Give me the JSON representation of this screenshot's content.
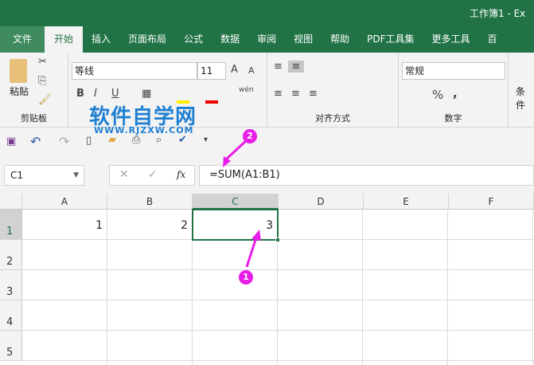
{
  "window": {
    "title": "工作簿1 - Ex"
  },
  "tabs": [
    "文件",
    "开始",
    "插入",
    "页面布局",
    "公式",
    "数据",
    "审阅",
    "视图",
    "帮助",
    "PDF工具集",
    "更多工具",
    "百"
  ],
  "ribbon": {
    "clipboard": {
      "paste": "粘贴",
      "label": "剪贴板"
    },
    "font": {
      "name": "等线",
      "size": "11",
      "phonetic": "wén"
    },
    "alignment": {
      "label": "对齐方式"
    },
    "number": {
      "format": "常规",
      "label": "数字",
      "percent": "%",
      "comma": ","
    },
    "styles": {
      "conditional": "条件"
    }
  },
  "watermark": {
    "text": "软件自学网",
    "url": "WWW.RJZXW.COM"
  },
  "formula_bar": {
    "name_box": "C1",
    "fx": "fx",
    "formula": "=SUM(A1:B1)"
  },
  "grid": {
    "columns": [
      "A",
      "B",
      "C",
      "D",
      "E",
      "F"
    ],
    "rows": [
      "1",
      "2",
      "3",
      "4",
      "5"
    ],
    "cells": {
      "A1": "1",
      "B1": "2",
      "C1": "3"
    },
    "selected": "C1"
  },
  "annotations": [
    "1",
    "2"
  ],
  "colors": {
    "accent": "#217346",
    "annotation": "#e81ee8",
    "watermark": "#1f7fd1"
  }
}
